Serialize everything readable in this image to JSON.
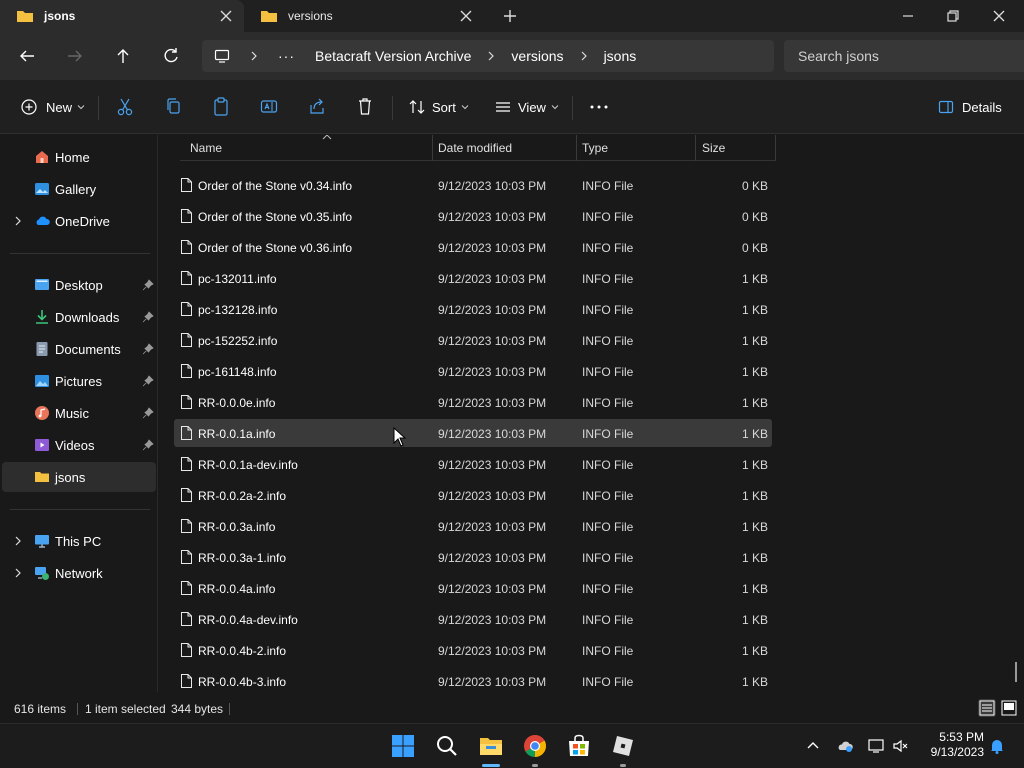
{
  "tabs": [
    {
      "label": "jsons",
      "active": true
    },
    {
      "label": "versions",
      "active": false
    }
  ],
  "breadcrumb": [
    "Betacraft Version Archive",
    "versions",
    "jsons"
  ],
  "search": {
    "placeholder": "Search jsons"
  },
  "commands": {
    "new_label": "New",
    "sort_label": "Sort",
    "view_label": "View",
    "details_label": "Details"
  },
  "sidebar": {
    "quick": [
      {
        "label": "Home"
      },
      {
        "label": "Gallery"
      },
      {
        "label": "OneDrive"
      }
    ],
    "pinned": [
      {
        "label": "Desktop"
      },
      {
        "label": "Downloads"
      },
      {
        "label": "Documents"
      },
      {
        "label": "Pictures"
      },
      {
        "label": "Music"
      },
      {
        "label": "Videos"
      },
      {
        "label": "jsons"
      }
    ],
    "bottom": [
      {
        "label": "This PC"
      },
      {
        "label": "Network"
      }
    ]
  },
  "columns": {
    "name": "Name",
    "date": "Date modified",
    "type": "Type",
    "size": "Size"
  },
  "files": [
    {
      "name": "Order of the Stone v0.34.info",
      "date": "9/12/2023 10:03 PM",
      "type": "INFO File",
      "size": "0 KB"
    },
    {
      "name": "Order of the Stone v0.35.info",
      "date": "9/12/2023 10:03 PM",
      "type": "INFO File",
      "size": "0 KB"
    },
    {
      "name": "Order of the Stone v0.36.info",
      "date": "9/12/2023 10:03 PM",
      "type": "INFO File",
      "size": "0 KB"
    },
    {
      "name": "pc-132011.info",
      "date": "9/12/2023 10:03 PM",
      "type": "INFO File",
      "size": "1 KB"
    },
    {
      "name": "pc-132128.info",
      "date": "9/12/2023 10:03 PM",
      "type": "INFO File",
      "size": "1 KB"
    },
    {
      "name": "pc-152252.info",
      "date": "9/12/2023 10:03 PM",
      "type": "INFO File",
      "size": "1 KB"
    },
    {
      "name": "pc-161148.info",
      "date": "9/12/2023 10:03 PM",
      "type": "INFO File",
      "size": "1 KB"
    },
    {
      "name": "RR-0.0.0e.info",
      "date": "9/12/2023 10:03 PM",
      "type": "INFO File",
      "size": "1 KB"
    },
    {
      "name": "RR-0.0.1a.info",
      "date": "9/12/2023 10:03 PM",
      "type": "INFO File",
      "size": "1 KB",
      "selected": true
    },
    {
      "name": "RR-0.0.1a-dev.info",
      "date": "9/12/2023 10:03 PM",
      "type": "INFO File",
      "size": "1 KB"
    },
    {
      "name": "RR-0.0.2a-2.info",
      "date": "9/12/2023 10:03 PM",
      "type": "INFO File",
      "size": "1 KB"
    },
    {
      "name": "RR-0.0.3a.info",
      "date": "9/12/2023 10:03 PM",
      "type": "INFO File",
      "size": "1 KB"
    },
    {
      "name": "RR-0.0.3a-1.info",
      "date": "9/12/2023 10:03 PM",
      "type": "INFO File",
      "size": "1 KB"
    },
    {
      "name": "RR-0.0.4a.info",
      "date": "9/12/2023 10:03 PM",
      "type": "INFO File",
      "size": "1 KB"
    },
    {
      "name": "RR-0.0.4a-dev.info",
      "date": "9/12/2023 10:03 PM",
      "type": "INFO File",
      "size": "1 KB"
    },
    {
      "name": "RR-0.0.4b-2.info",
      "date": "9/12/2023 10:03 PM",
      "type": "INFO File",
      "size": "1 KB"
    },
    {
      "name": "RR-0.0.4b-3.info",
      "date": "9/12/2023 10:03 PM",
      "type": "INFO File",
      "size": "1 KB"
    }
  ],
  "status": {
    "item_count": "616 items",
    "selection": "1 item selected",
    "selection_size": "344 bytes"
  },
  "clock": {
    "time": "5:53 PM",
    "date": "9/13/2023"
  },
  "colors": {
    "accent": "#0078d4",
    "folder": "#f3c03f",
    "selected_row": "#3a3a3a"
  }
}
